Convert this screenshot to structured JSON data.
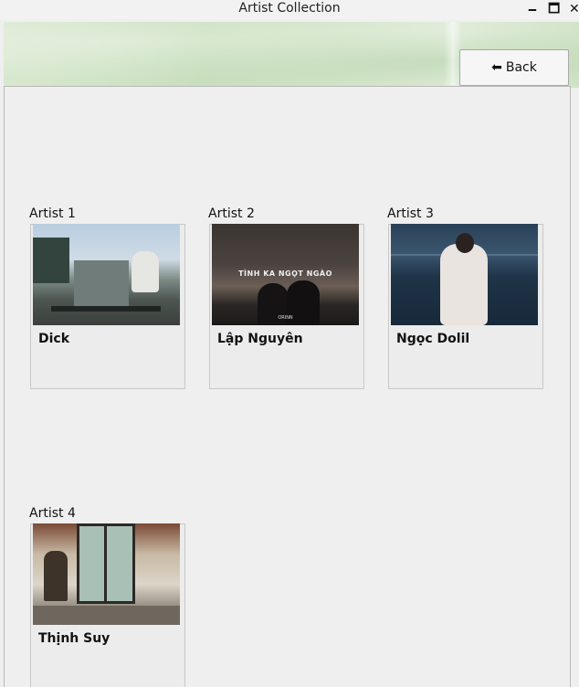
{
  "window": {
    "title": "Artist Collection",
    "minimize_glyph": "🗕",
    "maximize_glyph": "🗖",
    "close_glyph": "✕"
  },
  "toolbar": {
    "back_icon": "⬅",
    "back_label": "Back"
  },
  "artists": [
    {
      "label": "Artist 1",
      "name": "Dick"
    },
    {
      "label": "Artist 2",
      "name": "Lập Nguyên",
      "image_text": "TÌNH KA NGỌT NGÀO",
      "image_subtext": "ORINN"
    },
    {
      "label": "Artist 3",
      "name": "Ngọc Dolil"
    },
    {
      "label": "Artist 4",
      "name": "Thịnh Suy"
    }
  ]
}
